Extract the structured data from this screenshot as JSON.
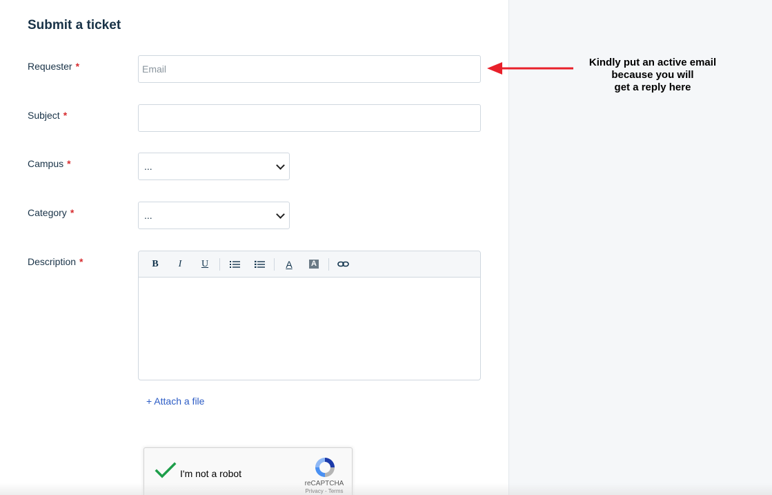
{
  "form": {
    "title": "Submit a ticket",
    "required_mark": "*",
    "requester": {
      "label": "Requester",
      "placeholder": "Email",
      "value": ""
    },
    "subject": {
      "label": "Subject",
      "value": ""
    },
    "campus": {
      "label": "Campus",
      "selected": "..."
    },
    "category": {
      "label": "Category",
      "selected": "..."
    },
    "description": {
      "label": "Description",
      "toolbar": {
        "bold": "B",
        "italic": "I",
        "underline": "U",
        "font_color": "A",
        "bg_color": "A"
      }
    },
    "attach_label": "+ Attach a file"
  },
  "captcha": {
    "label": "I'm not a robot",
    "brand": "reCAPTCHA",
    "links": "Privacy - Terms",
    "checked": true
  },
  "annotation": {
    "line1": "Kindly put an active email",
    "line2": "because you will",
    "line3": "get a reply here",
    "arrow_color": "#e8202a"
  },
  "colors": {
    "accent": "#2c5cc5",
    "required": "#d72d30",
    "check": "#1e9e4a"
  }
}
